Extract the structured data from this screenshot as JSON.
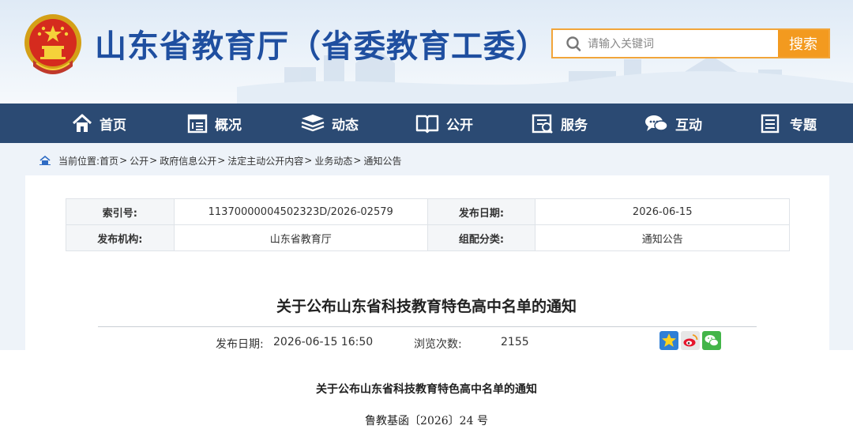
{
  "header": {
    "site_title": "山东省教育厅（省委教育工委）",
    "search_placeholder": "请输入关键词",
    "search_button": "搜索"
  },
  "nav": {
    "items": [
      {
        "label": "首页",
        "icon": "home-icon"
      },
      {
        "label": "概况",
        "icon": "overview-icon"
      },
      {
        "label": "动态",
        "icon": "news-icon"
      },
      {
        "label": "公开",
        "icon": "book-icon"
      },
      {
        "label": "服务",
        "icon": "service-icon"
      },
      {
        "label": "互动",
        "icon": "chat-icon"
      },
      {
        "label": "专题",
        "icon": "topic-icon"
      }
    ]
  },
  "breadcrumb": {
    "prefix": "当前位置:",
    "items": [
      "首页",
      "公开",
      "政府信息公开",
      "法定主动公开内容",
      "业务动态",
      "通知公告"
    ],
    "separator": ">"
  },
  "meta": {
    "index_label": "索引号:",
    "index_value": "11370000004502323D/2026-02579",
    "date_label": "发布日期:",
    "date_value": "2026-06-15",
    "org_label": "发布机构:",
    "org_value": "山东省教育厅",
    "category_label": "组配分类:",
    "category_value": "通知公告"
  },
  "article": {
    "title": "关于公布山东省科技教育特色高中名单的通知",
    "publish_label": "发布日期:",
    "publish_value": "2026-06-15 16:50",
    "views_label": "浏览次数:",
    "views_value": "2155",
    "body_title": "关于公布山东省科技教育特色高中名单的通知",
    "doc_number": "鲁教基函〔2026〕24 号"
  },
  "share": [
    "qzone-icon",
    "weibo-icon",
    "wechat-icon"
  ],
  "colors": {
    "brand_blue": "#1f4fa0",
    "nav_bg": "#2b4a73",
    "search_orange": "#f39a1f"
  }
}
